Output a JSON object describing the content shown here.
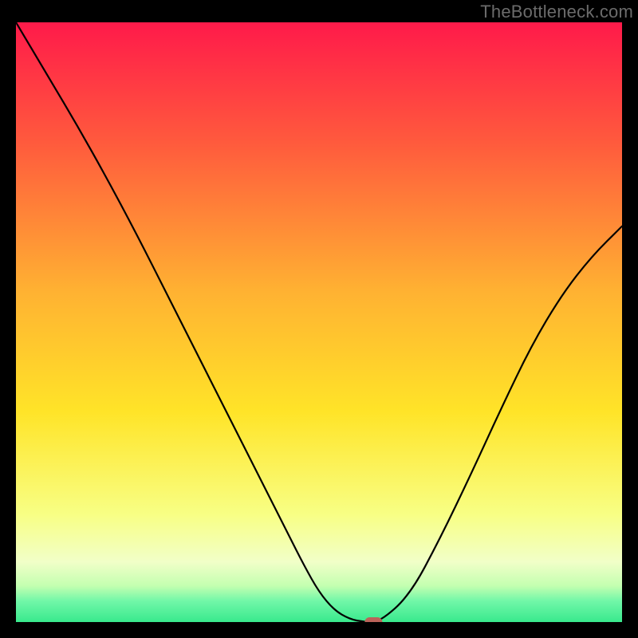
{
  "attribution": "TheBottleneck.com",
  "chart_data": {
    "type": "line",
    "title": "",
    "xlabel": "",
    "ylabel": "",
    "xlim": [
      0,
      1
    ],
    "ylim": [
      0,
      1
    ],
    "x": [
      0.0,
      0.05,
      0.1,
      0.15,
      0.2,
      0.25,
      0.3,
      0.35,
      0.4,
      0.45,
      0.475,
      0.5,
      0.525,
      0.55,
      0.575,
      0.6,
      0.65,
      0.7,
      0.75,
      0.8,
      0.85,
      0.9,
      0.95,
      1.0
    ],
    "values": [
      1.0,
      0.915,
      0.83,
      0.74,
      0.645,
      0.545,
      0.445,
      0.345,
      0.245,
      0.145,
      0.095,
      0.05,
      0.02,
      0.005,
      0.0,
      0.0,
      0.045,
      0.14,
      0.245,
      0.355,
      0.46,
      0.545,
      0.61,
      0.66
    ],
    "marker_x": 0.59,
    "marker_y": 0.0,
    "gradient_stops": [
      {
        "offset": 0.0,
        "color": "#ff1a4a"
      },
      {
        "offset": 0.2,
        "color": "#ff5a3d"
      },
      {
        "offset": 0.45,
        "color": "#ffb232"
      },
      {
        "offset": 0.65,
        "color": "#ffe428"
      },
      {
        "offset": 0.82,
        "color": "#f8ff84"
      },
      {
        "offset": 0.9,
        "color": "#f1ffc8"
      },
      {
        "offset": 0.94,
        "color": "#c3ffb0"
      },
      {
        "offset": 0.965,
        "color": "#71f7a8"
      },
      {
        "offset": 1.0,
        "color": "#39e98d"
      }
    ]
  }
}
